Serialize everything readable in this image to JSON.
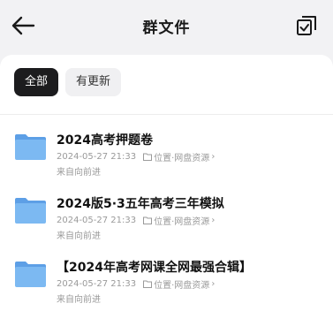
{
  "header": {
    "title": "群文件",
    "back_icon": "arrow-left-icon",
    "select_icon": "multi-select-icon"
  },
  "filters": {
    "all_label": "全部",
    "updated_label": "有更新"
  },
  "files": [
    {
      "name": "2024高考押题卷",
      "time": "2024-05-27 21:33",
      "location": "位置·网盘资源",
      "uploader": "来自向前进"
    },
    {
      "name": "2024版5·3五年高考三年模拟",
      "time": "2024-05-27 21:33",
      "location": "位置·网盘资源",
      "uploader": "来自向前进"
    },
    {
      "name": "【2024年高考网课全网最强合辑】",
      "time": "2024-05-27 21:33",
      "location": "位置·网盘资源",
      "uploader": "来自向前进"
    }
  ],
  "colors": {
    "folder": "#6aaef0",
    "active_chip": "#1c1c1e"
  }
}
